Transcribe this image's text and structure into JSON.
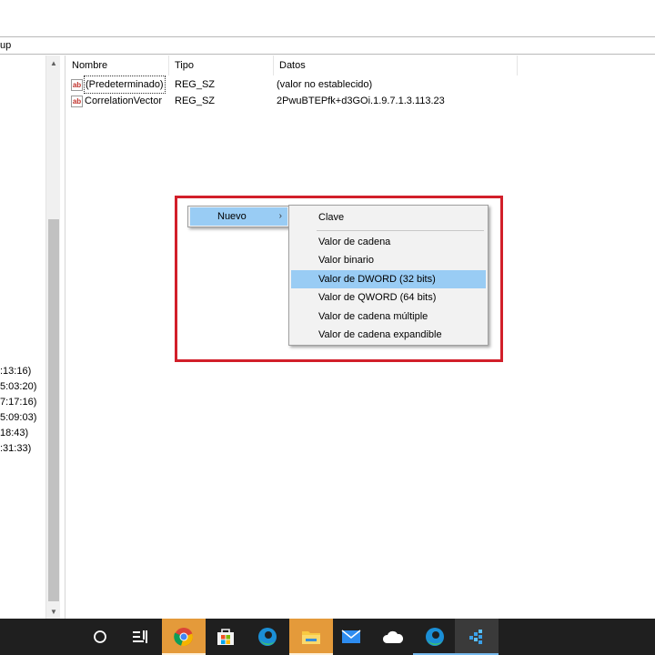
{
  "address_bar": {
    "path_tail": "up"
  },
  "tree_rows": [
    {
      "text": ":13:16)"
    },
    {
      "text": "5:03:20)"
    },
    {
      "text": "7:17:16)"
    },
    {
      "text": "5:09:03)"
    },
    {
      "text": "18:43)"
    },
    {
      "text": ":31:33)"
    }
  ],
  "list": {
    "headers": {
      "name": "Nombre",
      "type": "Tipo",
      "data": "Datos"
    },
    "rows": [
      {
        "icon": "ab",
        "name": "(Predeterminado)",
        "type": "REG_SZ",
        "data": "(valor no establecido)"
      },
      {
        "icon": "ab",
        "name": "CorrelationVector",
        "type": "REG_SZ",
        "data": "2PwuBTEPfk+d3GOi.1.9.7.1.3.113.23"
      }
    ]
  },
  "context_menu": {
    "main_item": "Nuevo",
    "chevron": "›",
    "submenu": [
      "Clave",
      "Valor de cadena",
      "Valor binario",
      "Valor de DWORD (32 bits)",
      "Valor de QWORD (64 bits)",
      "Valor de cadena múltiple",
      "Valor de cadena expandible"
    ],
    "highlighted_index": 3
  },
  "taskbar": {
    "icons": [
      "task-view-icon",
      "timeline-icon",
      "chrome-icon",
      "store-icon",
      "edge-icon",
      "file-explorer-icon",
      "mail-icon",
      "onedrive-icon",
      "edge-dev-icon",
      "regedit-icon"
    ]
  },
  "colors": {
    "highlight": "#99ccf4",
    "red_frame": "#d21f2a",
    "taskbar": "#1f1f1f"
  }
}
